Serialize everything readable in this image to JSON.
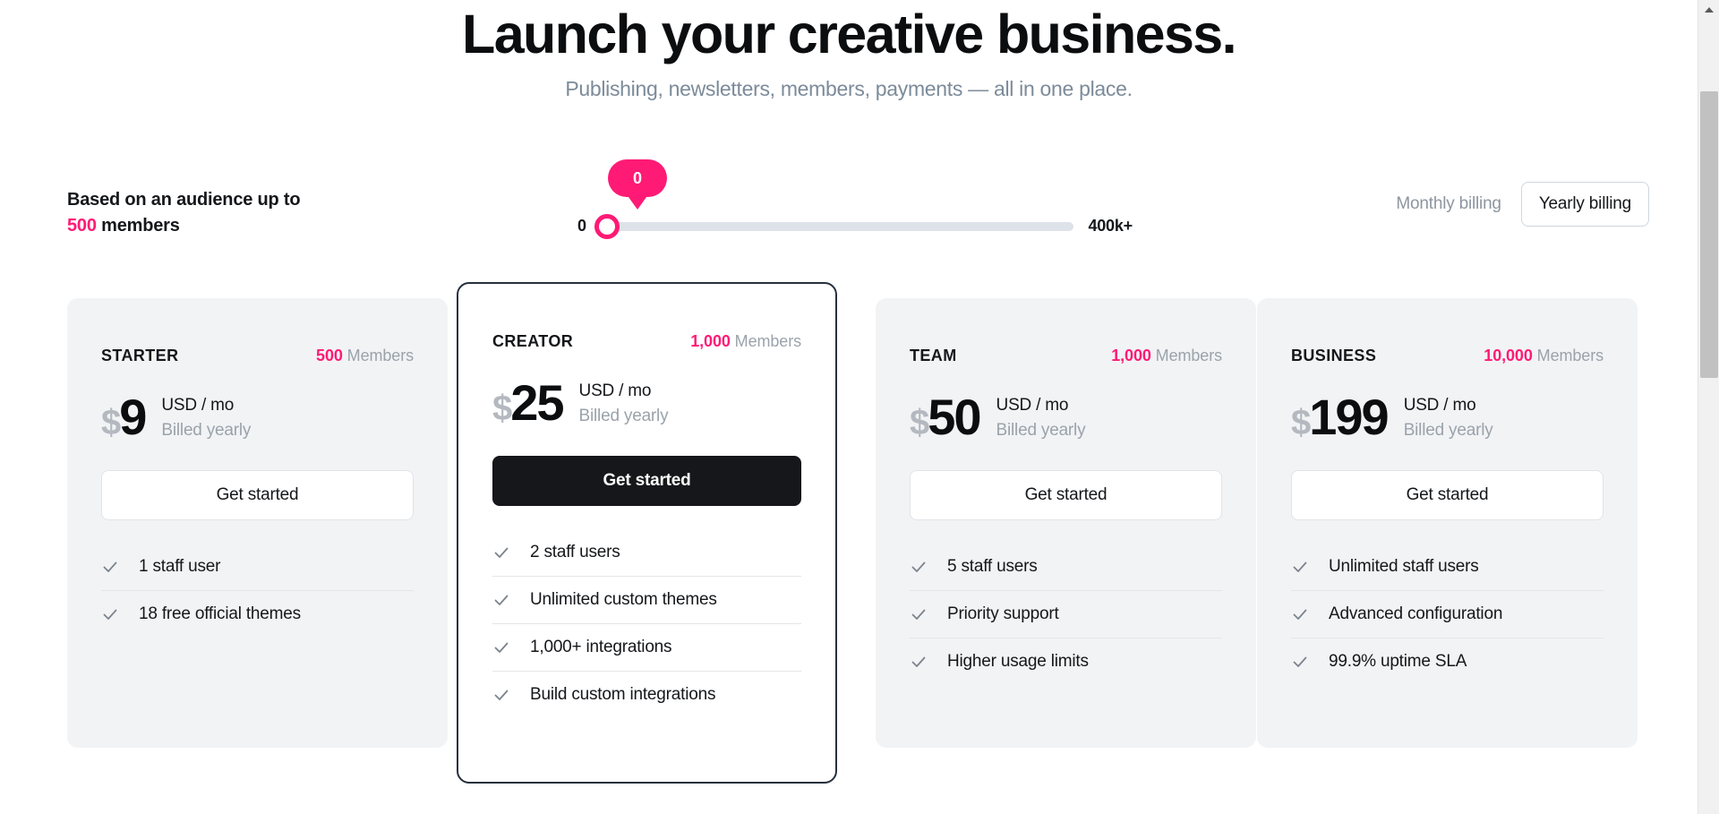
{
  "hero": {
    "title": "Launch your creative business.",
    "subtitle": "Publishing, newsletters, members, payments — all in one place."
  },
  "controls": {
    "audience_prefix": "Based on an audience up to",
    "audience_count": "500",
    "audience_suffix": "members",
    "slider": {
      "bubble_value": "0",
      "min_label": "0",
      "max_label": "400k+",
      "value": 0,
      "percent": 0
    },
    "billing": {
      "monthly_label": "Monthly billing",
      "yearly_label": "Yearly billing",
      "selected": "Yearly billing"
    }
  },
  "accent_color": "#ff1a75",
  "plans": [
    {
      "name": "STARTER",
      "members_count": "500",
      "members_label": "Members",
      "currency": "$",
      "price": "9",
      "unit": "USD / mo",
      "cycle": "Billed yearly",
      "cta": "Get started",
      "features": [
        "1 staff user",
        "18 free official themes"
      ]
    },
    {
      "name": "CREATOR",
      "members_count": "1,000",
      "members_label": "Members",
      "currency": "$",
      "price": "25",
      "unit": "USD / mo",
      "cycle": "Billed yearly",
      "cta": "Get started",
      "features": [
        "2 staff users",
        "Unlimited custom themes",
        "1,000+ integrations",
        "Build custom integrations"
      ]
    },
    {
      "name": "TEAM",
      "members_count": "1,000",
      "members_label": "Members",
      "currency": "$",
      "price": "50",
      "unit": "USD / mo",
      "cycle": "Billed yearly",
      "cta": "Get started",
      "features": [
        "5 staff users",
        "Priority support",
        "Higher usage limits"
      ]
    },
    {
      "name": "BUSINESS",
      "members_count": "10,000",
      "members_label": "Members",
      "currency": "$",
      "price": "199",
      "unit": "USD / mo",
      "cycle": "Billed yearly",
      "cta": "Get started",
      "features": [
        "Unlimited staff users",
        "Advanced configuration",
        "99.9% uptime SLA"
      ]
    }
  ]
}
